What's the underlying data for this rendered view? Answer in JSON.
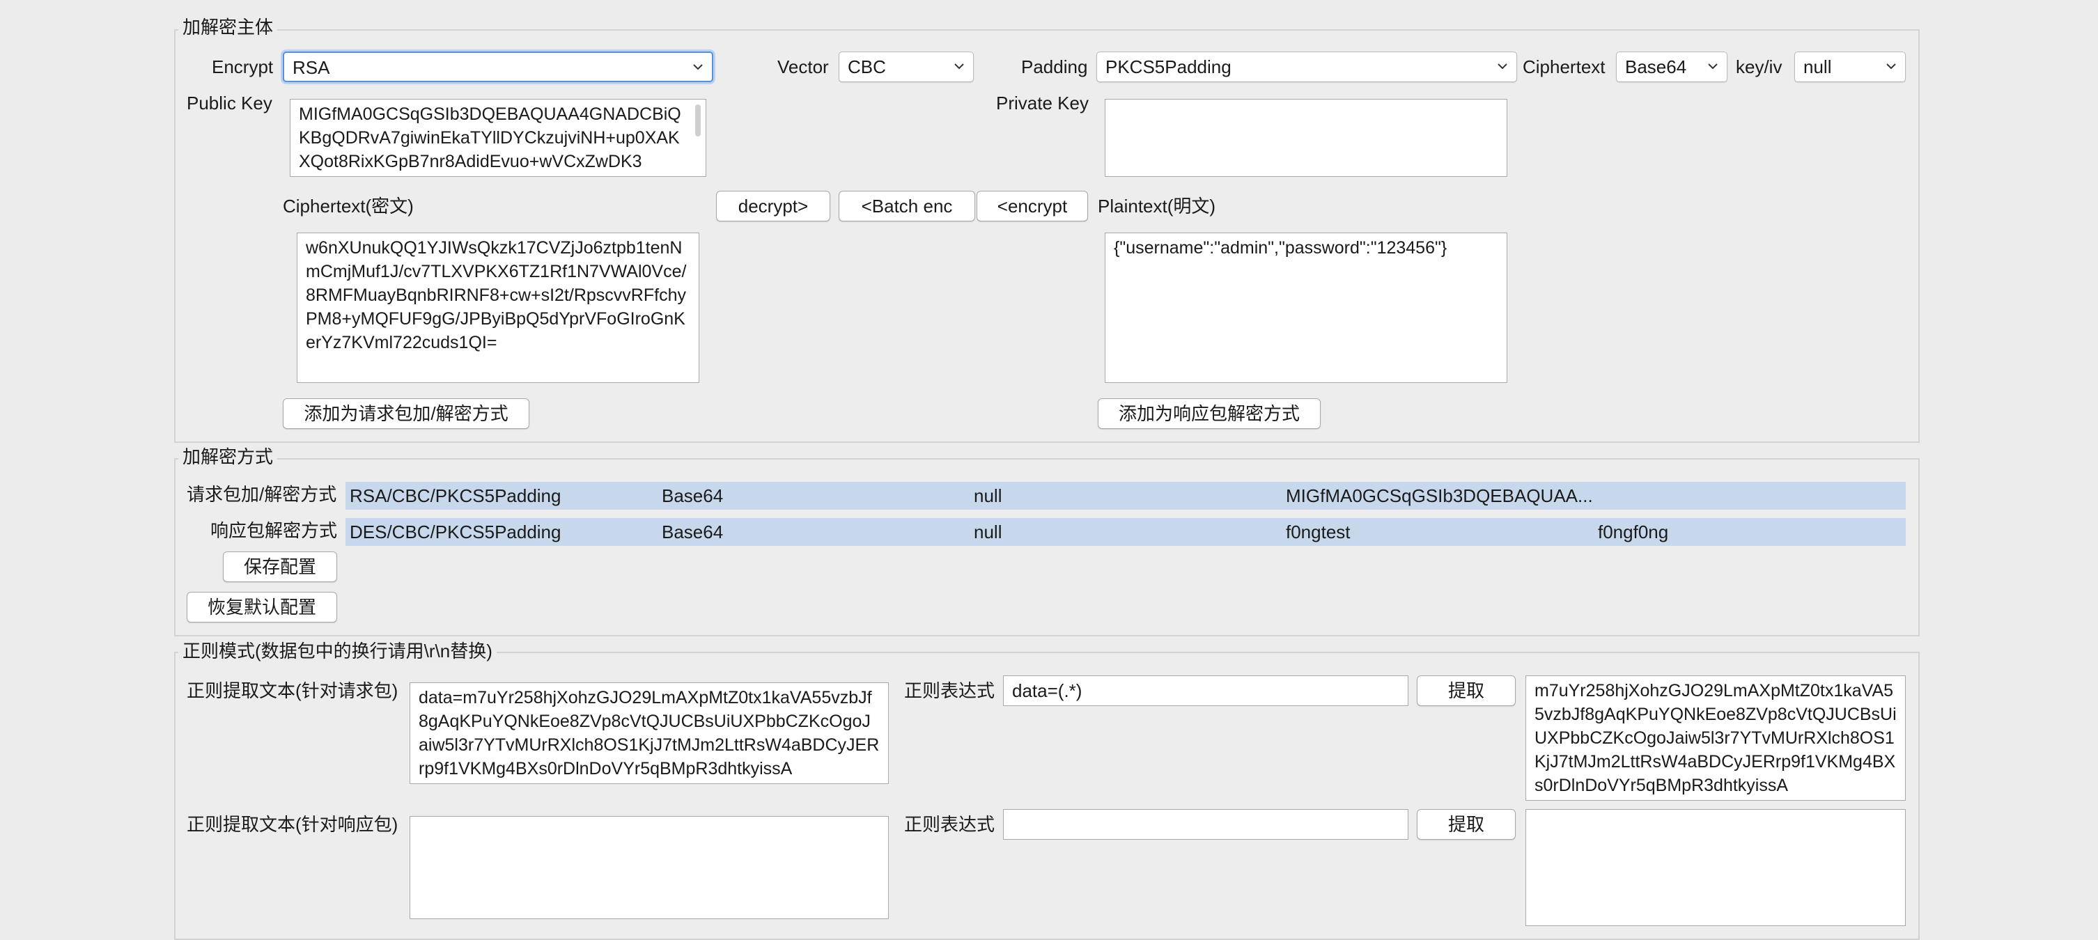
{
  "sections": {
    "main_title": "加解密主体",
    "mode_title": "加解密方式",
    "regex_title": "正则模式(数据包中的换行请用\\r\\n替换)"
  },
  "encrypt": {
    "label": "Encrypt",
    "value": "RSA",
    "vector_label": "Vector",
    "vector_value": "CBC",
    "padding_label": "Padding",
    "padding_value": "PKCS5Padding",
    "ciphertext_label": "Ciphertext",
    "ciphertext_value": "Base64",
    "keyiv_label": "key/iv",
    "keyiv_value": "null"
  },
  "keys": {
    "public_label": "Public Key",
    "public_value": "MIGfMA0GCSqGSIb3DQEBAQUAA4GNADCBiQKBgQDRvA7giwinEkaTYllDYCkzujviNH+up0XAKXQot8RixKGpB7nr8AdidEvuo+wVCxZwDK3",
    "private_label": "Private Key",
    "private_value": ""
  },
  "cipher": {
    "label": "Ciphertext(密文)",
    "value": "w6nXUnukQQ1YJIWsQkzk17CVZjJo6ztpb1tenNmCmjMuf1J/cv7TLXVPKX6TZ1Rf1N7VWAl0Vce/8RMFMuayBqnbRIRNF8+cw+sI2t/RpscvvRFfchyPM8+yMQFUF9gG/JPByiBpQ5dYprVFoGIroGnKerYz7KVml722cuds1QI=",
    "add_button": "添加为请求包加/解密方式"
  },
  "plain": {
    "label": "Plaintext(明文)",
    "value": "{\"username\":\"admin\",\"password\":\"123456\"}",
    "add_button": "添加为响应包解密方式"
  },
  "buttons": {
    "decrypt": "decrypt>",
    "batch_enc": "<Batch enc",
    "encrypt": "<encrypt",
    "save": "保存配置",
    "restore": "恢复默认配置",
    "extract1": "提取",
    "extract2": "提取"
  },
  "modes": {
    "request_label": "请求包加/解密方式",
    "request_cols": [
      "RSA/CBC/PKCS5Padding",
      "Base64",
      "null",
      "MIGfMA0GCSqGSIb3DQEBAQUAA..."
    ],
    "response_label": "响应包解密方式",
    "response_cols": [
      "DES/CBC/PKCS5Padding",
      "Base64",
      "null",
      "f0ngtest",
      "f0ngf0ng"
    ]
  },
  "regex": {
    "req_label": "正则提取文本(针对请求包)",
    "req_text": "data=m7uYr258hjXohzGJO29LmAXpMtZ0tx1kaVA55vzbJf8gAqKPuYQNkEoe8ZVp8cVtQJUCBsUiUXPbbCZKcOgoJaiw5l3r7YTvMUrRXlch8OS1KjJ7tMJm2LttRsW4aBDCyJERrp9f1VKMg4BXs0rDlnDoVYr5qBMpR3dhtkyissA",
    "expr_label1": "正则表达式",
    "expr_value1": "data=(.*)",
    "result1": "m7uYr258hjXohzGJO29LmAXpMtZ0tx1kaVA55vzbJf8gAqKPuYQNkEoe8ZVp8cVtQJUCBsUiUXPbbCZKcOgoJaiw5l3r7YTvMUrRXlch8OS1KjJ7tMJm2LttRsW4aBDCyJERrp9f1VKMg4BXs0rDlnDoVYr5qBMpR3dhtkyissA",
    "resp_label": "正则提取文本(针对响应包)",
    "resp_text": "",
    "expr_label2": "正则表达式",
    "expr_value2": "",
    "result2": ""
  }
}
